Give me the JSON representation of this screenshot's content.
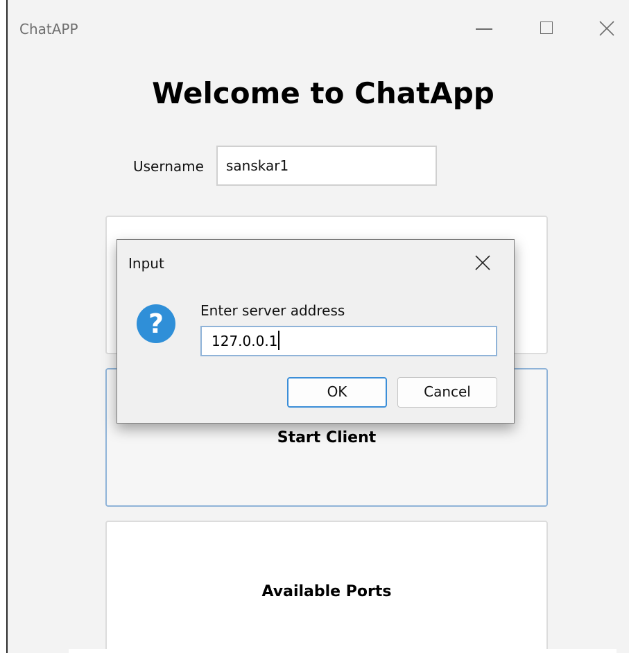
{
  "window": {
    "title": "ChatAPP"
  },
  "main": {
    "heading": "Welcome to ChatApp",
    "username_label": "Username",
    "username_value": "sanskar1",
    "cards": {
      "start_client": "Start Client",
      "available_ports": "Available Ports"
    }
  },
  "dialog": {
    "title": "Input",
    "prompt": "Enter server address",
    "input_value": "127.0.0.1",
    "ok_label": "OK",
    "cancel_label": "Cancel",
    "icon": "question-icon"
  },
  "colors": {
    "accent": "#3b8ed8",
    "question_icon": "#2f8fd8",
    "focus_border": "#8fb3d8"
  }
}
